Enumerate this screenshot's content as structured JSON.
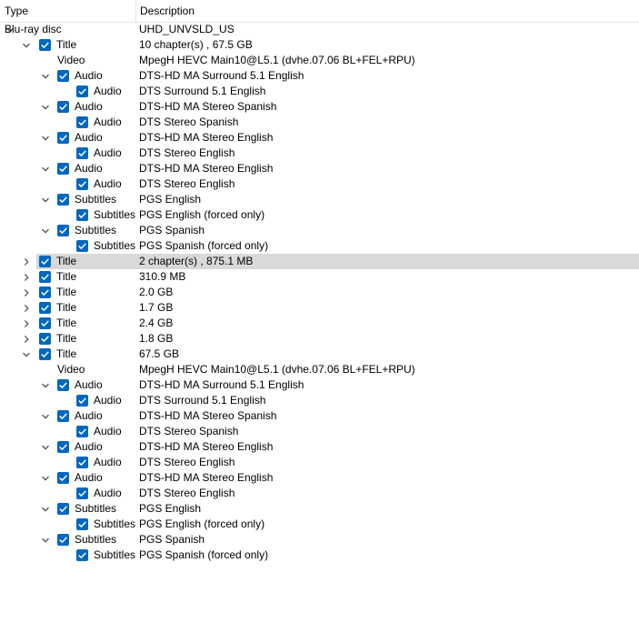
{
  "header": {
    "type_label": "Type",
    "description_label": "Description"
  },
  "rows": [
    {
      "level": 0,
      "expander": "down",
      "checkbox": false,
      "type": "Blu-ray disc",
      "desc": "UHD_UNVSLD_US"
    },
    {
      "level": 1,
      "expander": "down",
      "checkbox": true,
      "type": "Title",
      "desc": "10 chapter(s) , 67.5 GB"
    },
    {
      "level": 2,
      "expander": "none",
      "checkbox": false,
      "type": "Video",
      "desc": "MpegH HEVC Main10@L5.1 (dvhe.07.06 BL+FEL+RPU)"
    },
    {
      "level": 2,
      "expander": "down",
      "checkbox": true,
      "type": "Audio",
      "desc": "DTS-HD MA Surround 5.1 English"
    },
    {
      "level": 3,
      "expander": "none",
      "checkbox": true,
      "type": "Audio",
      "desc": "DTS Surround 5.1 English"
    },
    {
      "level": 2,
      "expander": "down",
      "checkbox": true,
      "type": "Audio",
      "desc": "DTS-HD MA Stereo Spanish"
    },
    {
      "level": 3,
      "expander": "none",
      "checkbox": true,
      "type": "Audio",
      "desc": "DTS Stereo Spanish"
    },
    {
      "level": 2,
      "expander": "down",
      "checkbox": true,
      "type": "Audio",
      "desc": "DTS-HD MA Stereo English"
    },
    {
      "level": 3,
      "expander": "none",
      "checkbox": true,
      "type": "Audio",
      "desc": "DTS Stereo English"
    },
    {
      "level": 2,
      "expander": "down",
      "checkbox": true,
      "type": "Audio",
      "desc": "DTS-HD MA Stereo English"
    },
    {
      "level": 3,
      "expander": "none",
      "checkbox": true,
      "type": "Audio",
      "desc": "DTS Stereo English"
    },
    {
      "level": 2,
      "expander": "down",
      "checkbox": true,
      "type": "Subtitles",
      "desc": "PGS English"
    },
    {
      "level": 3,
      "expander": "none",
      "checkbox": true,
      "type": "Subtitles",
      "desc": "PGS English  (forced only)"
    },
    {
      "level": 2,
      "expander": "down",
      "checkbox": true,
      "type": "Subtitles",
      "desc": "PGS Spanish"
    },
    {
      "level": 3,
      "expander": "none",
      "checkbox": true,
      "type": "Subtitles",
      "desc": "PGS Spanish  (forced only)"
    },
    {
      "level": 1,
      "expander": "right",
      "checkbox": true,
      "type": "Title",
      "desc": "2 chapter(s) , 875.1 MB",
      "selected": true
    },
    {
      "level": 1,
      "expander": "right",
      "checkbox": true,
      "type": "Title",
      "desc": "310.9 MB"
    },
    {
      "level": 1,
      "expander": "right",
      "checkbox": true,
      "type": "Title",
      "desc": "2.0 GB"
    },
    {
      "level": 1,
      "expander": "right",
      "checkbox": true,
      "type": "Title",
      "desc": "1.7 GB"
    },
    {
      "level": 1,
      "expander": "right",
      "checkbox": true,
      "type": "Title",
      "desc": "2.4 GB"
    },
    {
      "level": 1,
      "expander": "right",
      "checkbox": true,
      "type": "Title",
      "desc": "1.8 GB"
    },
    {
      "level": 1,
      "expander": "down",
      "checkbox": true,
      "type": "Title",
      "desc": "67.5 GB"
    },
    {
      "level": 2,
      "expander": "none",
      "checkbox": false,
      "type": "Video",
      "desc": "MpegH HEVC Main10@L5.1 (dvhe.07.06 BL+FEL+RPU)"
    },
    {
      "level": 2,
      "expander": "down",
      "checkbox": true,
      "type": "Audio",
      "desc": "DTS-HD MA Surround 5.1 English"
    },
    {
      "level": 3,
      "expander": "none",
      "checkbox": true,
      "type": "Audio",
      "desc": "DTS Surround 5.1 English"
    },
    {
      "level": 2,
      "expander": "down",
      "checkbox": true,
      "type": "Audio",
      "desc": "DTS-HD MA Stereo Spanish"
    },
    {
      "level": 3,
      "expander": "none",
      "checkbox": true,
      "type": "Audio",
      "desc": "DTS Stereo Spanish"
    },
    {
      "level": 2,
      "expander": "down",
      "checkbox": true,
      "type": "Audio",
      "desc": "DTS-HD MA Stereo English"
    },
    {
      "level": 3,
      "expander": "none",
      "checkbox": true,
      "type": "Audio",
      "desc": "DTS Stereo English"
    },
    {
      "level": 2,
      "expander": "down",
      "checkbox": true,
      "type": "Audio",
      "desc": "DTS-HD MA Stereo English"
    },
    {
      "level": 3,
      "expander": "none",
      "checkbox": true,
      "type": "Audio",
      "desc": "DTS Stereo English"
    },
    {
      "level": 2,
      "expander": "down",
      "checkbox": true,
      "type": "Subtitles",
      "desc": "PGS English"
    },
    {
      "level": 3,
      "expander": "none",
      "checkbox": true,
      "type": "Subtitles",
      "desc": "PGS English  (forced only)"
    },
    {
      "level": 2,
      "expander": "down",
      "checkbox": true,
      "type": "Subtitles",
      "desc": "PGS Spanish"
    },
    {
      "level": 3,
      "expander": "none",
      "checkbox": true,
      "type": "Subtitles",
      "desc": "PGS Spanish  (forced only)"
    }
  ],
  "colors": {
    "checkbox": "#0067c0",
    "selection": "#d9d9d9"
  },
  "icons": {
    "expanded": "chevron-down-icon",
    "collapsed": "chevron-right-icon",
    "checked": "checkbox-checked-icon"
  }
}
